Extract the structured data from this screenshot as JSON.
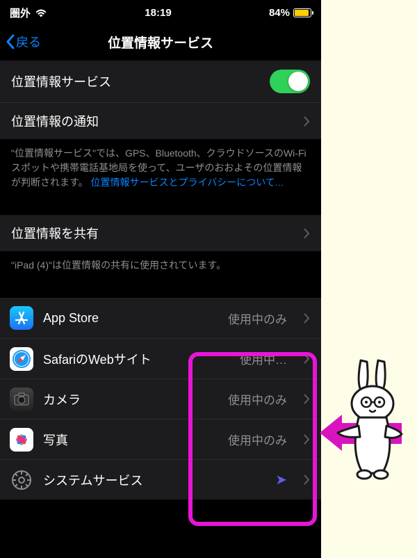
{
  "status": {
    "carrier": "圏外",
    "time": "18:19",
    "battery": "84%"
  },
  "nav": {
    "back": "戻る",
    "title": "位置情報サービス"
  },
  "cells": {
    "main_toggle": "位置情報サービス",
    "alerts": "位置情報の通知",
    "share": "位置情報を共有"
  },
  "footer1": {
    "text": "\"位置情報サービス\"では、GPS、Bluetooth、クラウドソースのWi-Fiスポットや携帯電話基地局を使って、ユーザのおおよその位置情報が判断されます。",
    "link": "位置情報サービスとプライバシーについて..."
  },
  "footer2": "\"iPad (4)\"は位置情報の共有に使用されています。",
  "apps": [
    {
      "name": "App Store",
      "status": "使用中のみ",
      "icon": "appstore"
    },
    {
      "name": "SafariのWebサイト",
      "status": "使用中…",
      "icon": "safari"
    },
    {
      "name": "カメラ",
      "status": "使用中のみ",
      "icon": "camera"
    },
    {
      "name": "写真",
      "status": "使用中のみ",
      "icon": "photos"
    },
    {
      "name": "システムサービス",
      "status": "",
      "icon": "system"
    }
  ]
}
